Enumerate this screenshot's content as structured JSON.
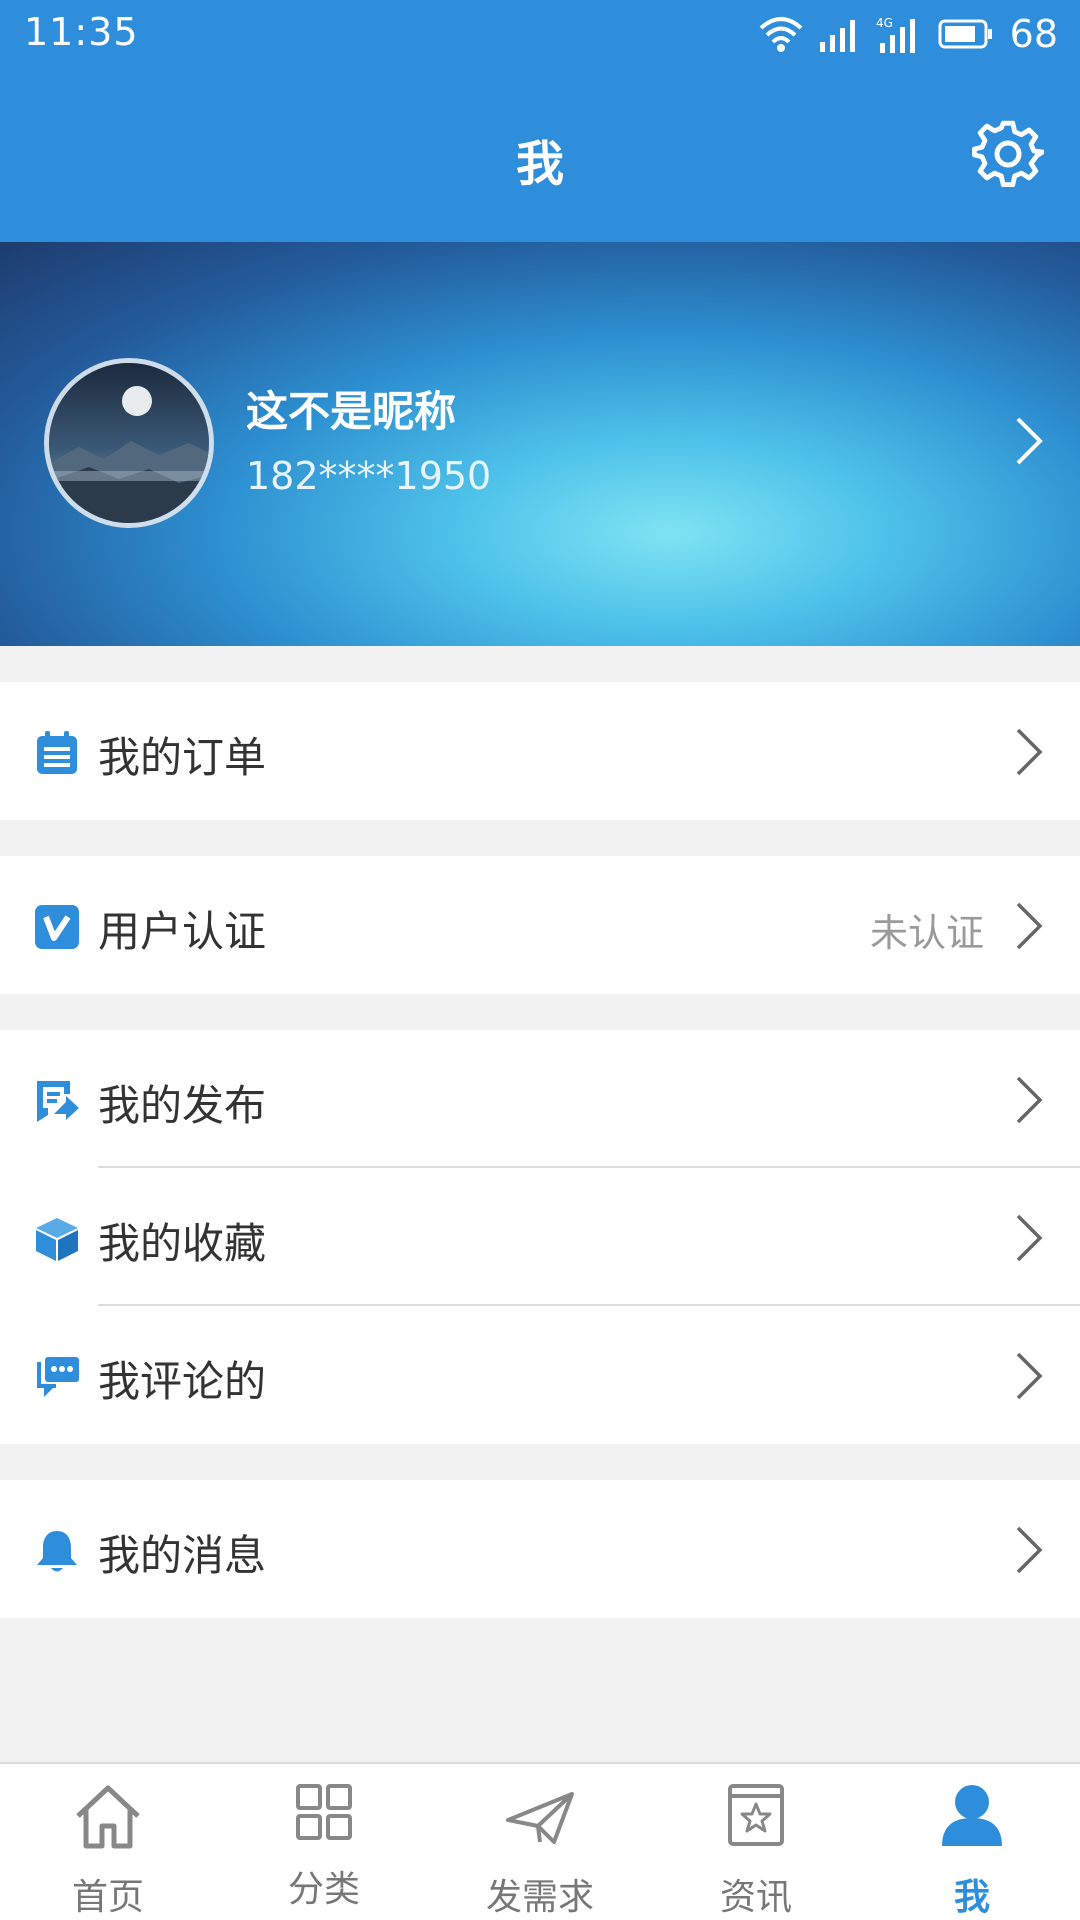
{
  "status_bar": {
    "time": "11:35",
    "network": "4G",
    "battery": "68",
    "icons": [
      "wifi-icon",
      "signal-icon",
      "signal-4g-icon",
      "battery-icon"
    ]
  },
  "header": {
    "title": "我",
    "settings_icon": "gear-icon"
  },
  "profile": {
    "nickname": "这不是昵称",
    "phone": "182****1950"
  },
  "menu": {
    "orders": {
      "label": "我的订单",
      "icon": "clipboard-icon"
    },
    "verify": {
      "label": "用户认证",
      "status": "未认证",
      "icon": "verified-v-icon"
    },
    "posts": {
      "label": "我的发布",
      "icon": "publish-icon"
    },
    "favorites": {
      "label": "我的收藏",
      "icon": "box-icon"
    },
    "comments": {
      "label": "我评论的",
      "icon": "comment-icon"
    },
    "messages": {
      "label": "我的消息",
      "icon": "bell-icon"
    }
  },
  "tab_bar": {
    "tabs": [
      {
        "label": "首页",
        "icon": "home-icon"
      },
      {
        "label": "分类",
        "icon": "grid-icon"
      },
      {
        "label": "发需求",
        "icon": "paper-plane-icon"
      },
      {
        "label": "资讯",
        "icon": "news-star-icon"
      },
      {
        "label": "我",
        "icon": "person-icon"
      }
    ],
    "active_index": 4
  },
  "colors": {
    "accent": "#2f8edc",
    "background": "#f2f2f2",
    "text_primary": "#333333",
    "text_secondary": "#9a9a9a"
  }
}
